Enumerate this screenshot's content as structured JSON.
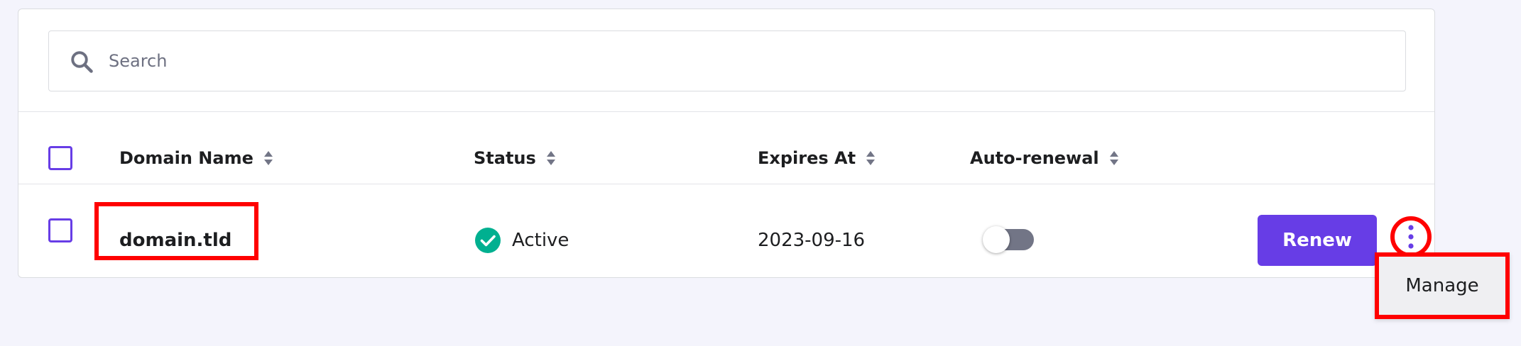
{
  "search": {
    "placeholder": "Search",
    "value": ""
  },
  "table": {
    "columns": [
      {
        "label": "Domain Name",
        "sortable": true
      },
      {
        "label": "Status",
        "sortable": true
      },
      {
        "label": "Expires At",
        "sortable": true
      },
      {
        "label": "Auto-renewal",
        "sortable": true
      }
    ],
    "rows": [
      {
        "domain": "domain.tld",
        "status": "Active",
        "expires_at": "2023-09-16",
        "auto_renewal": false,
        "action_label": "Renew",
        "selected": false
      }
    ]
  },
  "menu": {
    "items": [
      {
        "label": "Manage"
      }
    ]
  },
  "colors": {
    "accent": "#673de6",
    "status_active": "#00b090",
    "highlight": "#ff0000",
    "toggle_off": "#727586",
    "background": "#f4f4fc"
  },
  "icons": {
    "search": "search-icon",
    "sort": "sort-icon",
    "status": "check-circle-icon",
    "more": "more-vertical-icon"
  }
}
